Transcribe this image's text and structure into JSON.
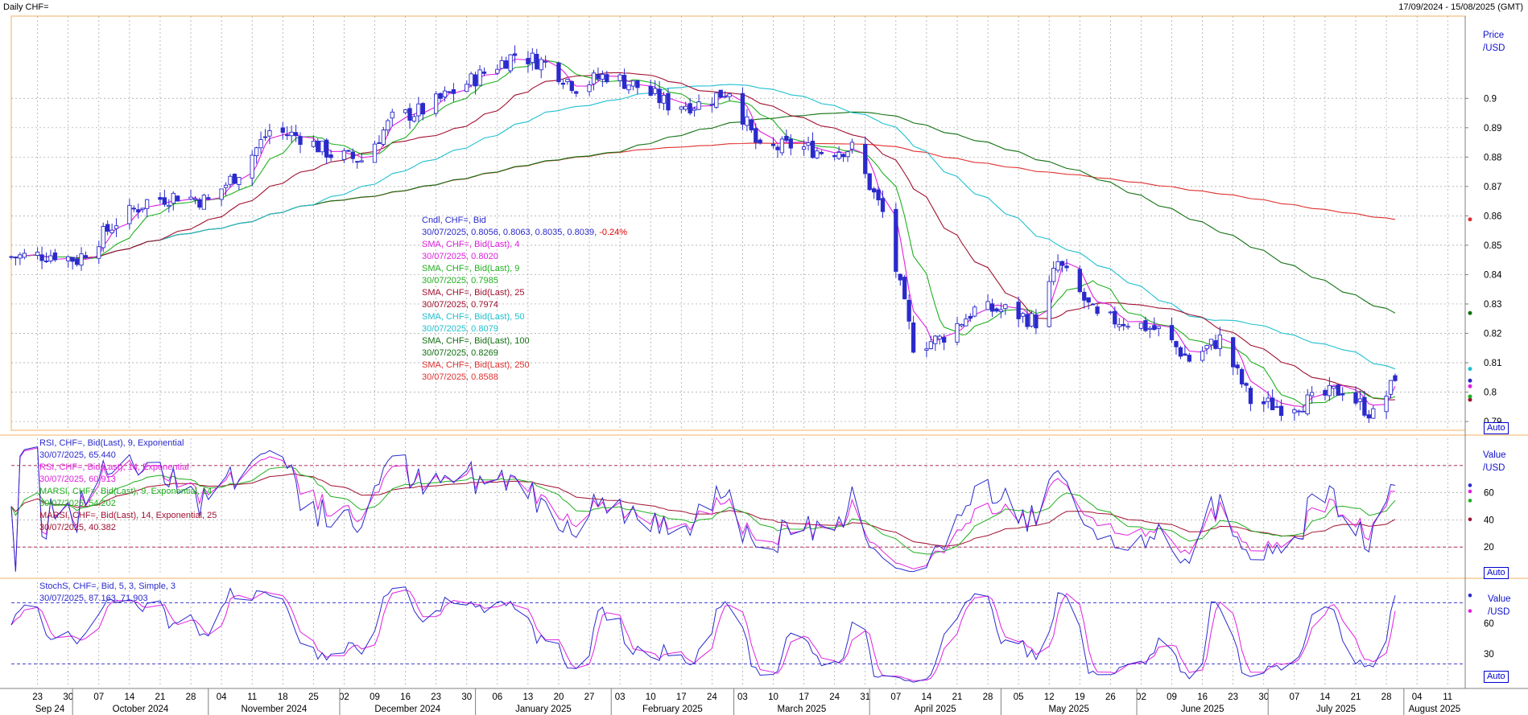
{
  "header": {
    "title": "Daily CHF=",
    "range": "17/09/2024 - 15/08/2025 (GMT)"
  },
  "price_panel": {
    "unit_top": "Price",
    "unit_bottom": "/USD",
    "auto_label": "Auto",
    "legend": [
      {
        "text": "Cndl, CHF=, Bid",
        "color": "#2a2acc"
      },
      {
        "text": "30/07/2025, 0.8056, 0.8063, 0.8035, 0.8039,",
        "color": "#2a2acc",
        "extra": "-0.24%",
        "extra_color": "#e00000"
      },
      {
        "text": "SMA, CHF=, Bid(Last),  4",
        "color": "#e020e0"
      },
      {
        "text": "30/07/2025, 0.8020",
        "color": "#e020e0"
      },
      {
        "text": "SMA, CHF=, Bid(Last),  9",
        "color": "#20b020"
      },
      {
        "text": "30/07/2025, 0.7985",
        "color": "#20b020"
      },
      {
        "text": "SMA, CHF=, Bid(Last),  25",
        "color": "#a01030"
      },
      {
        "text": "30/07/2025, 0.7974",
        "color": "#a01030"
      },
      {
        "text": "SMA, CHF=, Bid(Last),  50",
        "color": "#20c0d0"
      },
      {
        "text": "30/07/2025, 0.8079",
        "color": "#20c0d0"
      },
      {
        "text": "SMA, CHF=, Bid(Last),  100",
        "color": "#107010"
      },
      {
        "text": "30/07/2025, 0.8269",
        "color": "#107010"
      },
      {
        "text": "SMA, CHF=, Bid(Last),  250",
        "color": "#e03030"
      },
      {
        "text": "30/07/2025, 0.8588",
        "color": "#e03030"
      }
    ]
  },
  "rsi_panel": {
    "unit_top": "Value",
    "unit_bottom": "/USD",
    "auto_label": "Auto",
    "legend": [
      {
        "text": "RSI, CHF=, Bid(Last),  9, Exponential",
        "color": "#2a2acc"
      },
      {
        "text": "30/07/2025, 65.440",
        "color": "#2a2acc"
      },
      {
        "text": "RSI, CHF=, Bid(Last),  14, Exponential",
        "color": "#e020e0"
      },
      {
        "text": "30/07/2025, 60.913",
        "color": "#e020e0"
      },
      {
        "text": "MARSI, CHF=, Bid(Last),  9, Exponential,  14",
        "color": "#20b020"
      },
      {
        "text": "30/07/2025, 54.202",
        "color": "#20b020"
      },
      {
        "text": "MARSI, CHF=, Bid(Last),  14, Exponential,  25",
        "color": "#a01030"
      },
      {
        "text": "30/07/2025, 40.382",
        "color": "#a01030"
      }
    ]
  },
  "stoch_panel": {
    "unit_top": "Value",
    "unit_bottom": "/USD",
    "auto_label": "Auto",
    "legend": [
      {
        "text": "StochS, CHF=, Bid,  5, 3, Simple,  3",
        "color": "#2a2acc"
      },
      {
        "text": "30/07/2025, 87.163, 71.903",
        "color": "#2a2acc"
      }
    ]
  },
  "chart_data": [
    {
      "type": "candlestick",
      "title": "Daily CHF=",
      "ylim": [
        0.787,
        0.928
      ],
      "y_ticks": [
        "0.79",
        "0.8",
        "0.81",
        "0.82",
        "0.83",
        "0.84",
        "0.85",
        "0.86",
        "0.87",
        "0.88",
        "0.89",
        "0.9"
      ],
      "grid": true,
      "x_day_labels": [
        "23",
        "30",
        "07",
        "14",
        "21",
        "28",
        "04",
        "11",
        "18",
        "25",
        "02",
        "09",
        "16",
        "23",
        "30",
        "06",
        "13",
        "20",
        "27",
        "03",
        "10",
        "17",
        "24",
        "03",
        "10",
        "17",
        "24",
        "31",
        "07",
        "14",
        "21",
        "28",
        "05",
        "12",
        "19",
        "26",
        "02",
        "09",
        "16",
        "23",
        "30",
        "07",
        "14",
        "21",
        "28",
        "04",
        "11"
      ],
      "x_month_labels": [
        "Sep 24",
        "October 2024",
        "November 2024",
        "December 2024",
        "January 2025",
        "February 2025",
        "March 2025",
        "April 2025",
        "May 2025",
        "June 2025",
        "July 2025",
        "August 2025"
      ],
      "candle_anchors": [
        {
          "date": "2024-09-17",
          "close": 0.846
        },
        {
          "date": "2024-09-27",
          "close": 0.847
        },
        {
          "date": "2024-10-02",
          "close": 0.845
        },
        {
          "date": "2024-10-11",
          "close": 0.858
        },
        {
          "date": "2024-10-18",
          "close": 0.865
        },
        {
          "date": "2024-10-25",
          "close": 0.867
        },
        {
          "date": "2024-11-01",
          "close": 0.865
        },
        {
          "date": "2024-11-08",
          "close": 0.875
        },
        {
          "date": "2024-11-15",
          "close": 0.889
        },
        {
          "date": "2024-11-22",
          "close": 0.887
        },
        {
          "date": "2024-11-29",
          "close": 0.881
        },
        {
          "date": "2024-12-06",
          "close": 0.879
        },
        {
          "date": "2024-12-13",
          "close": 0.893
        },
        {
          "date": "2024-12-20",
          "close": 0.896
        },
        {
          "date": "2024-12-31",
          "close": 0.906
        },
        {
          "date": "2025-01-10",
          "close": 0.915
        },
        {
          "date": "2025-01-17",
          "close": 0.912
        },
        {
          "date": "2025-01-24",
          "close": 0.904
        },
        {
          "date": "2025-01-31",
          "close": 0.908
        },
        {
          "date": "2025-02-07",
          "close": 0.904
        },
        {
          "date": "2025-02-14",
          "close": 0.898
        },
        {
          "date": "2025-02-21",
          "close": 0.898
        },
        {
          "date": "2025-02-28",
          "close": 0.903
        },
        {
          "date": "2025-03-07",
          "close": 0.882
        },
        {
          "date": "2025-03-14",
          "close": 0.884
        },
        {
          "date": "2025-03-21",
          "close": 0.882
        },
        {
          "date": "2025-03-28",
          "close": 0.883
        },
        {
          "date": "2025-04-04",
          "close": 0.861
        },
        {
          "date": "2025-04-11",
          "close": 0.816
        },
        {
          "date": "2025-04-17",
          "close": 0.818
        },
        {
          "date": "2025-04-25",
          "close": 0.828
        },
        {
          "date": "2025-05-02",
          "close": 0.828
        },
        {
          "date": "2025-05-09",
          "close": 0.824
        },
        {
          "date": "2025-05-14",
          "close": 0.844
        },
        {
          "date": "2025-05-23",
          "close": 0.825
        },
        {
          "date": "2025-05-30",
          "close": 0.824
        },
        {
          "date": "2025-06-06",
          "close": 0.821
        },
        {
          "date": "2025-06-13",
          "close": 0.811
        },
        {
          "date": "2025-06-20",
          "close": 0.818
        },
        {
          "date": "2025-06-27",
          "close": 0.797
        },
        {
          "date": "2025-07-04",
          "close": 0.795
        },
        {
          "date": "2025-07-11",
          "close": 0.797
        },
        {
          "date": "2025-07-18",
          "close": 0.801
        },
        {
          "date": "2025-07-25",
          "close": 0.792
        },
        {
          "date": "2025-07-30",
          "close": 0.8039
        }
      ],
      "last_candle": {
        "date": "2025-07-30",
        "open": 0.8056,
        "high": 0.8063,
        "low": 0.8035,
        "close": 0.8039,
        "change": "-0.24%"
      },
      "sma_values": {
        "4": 0.802,
        "9": 0.7985,
        "25": 0.7974,
        "50": 0.8079,
        "100": 0.8269,
        "250": 0.8588
      },
      "series": [
        {
          "name": "Cndl, CHF=, Bid",
          "color": "#2a2acc"
        },
        {
          "name": "SMA, CHF=, Bid(Last),  4",
          "color": "#e020e0"
        },
        {
          "name": "SMA, CHF=, Bid(Last),  9",
          "color": "#20b020"
        },
        {
          "name": "SMA, CHF=, Bid(Last),  25",
          "color": "#a01030"
        },
        {
          "name": "SMA, CHF=, Bid(Last),  50",
          "color": "#20c0d0"
        },
        {
          "name": "SMA, CHF=, Bid(Last),  100",
          "color": "#107010"
        },
        {
          "name": "SMA, CHF=, Bid(Last),  250",
          "color": "#e03030"
        }
      ]
    },
    {
      "type": "line",
      "panel": "RSI",
      "ylim": [
        0,
        100
      ],
      "y_ticks": [
        "20",
        "40",
        "60"
      ],
      "reference_lines": [
        20,
        80
      ],
      "last_values": {
        "RSI 9": 65.44,
        "RSI 14": 60.913,
        "MARSI 9/14": 54.202,
        "MARSI 14/25": 40.382
      }
    },
    {
      "type": "line",
      "panel": "StochS",
      "ylim": [
        0,
        100
      ],
      "y_ticks": [
        "30",
        "60"
      ],
      "reference_lines": [
        20,
        80
      ],
      "last_values": {
        "%K": 87.163,
        "%D": 71.903
      }
    }
  ],
  "colors": {
    "candle": "#2a2acc",
    "grid": "#a0a0a0",
    "panel_border": "#f0b060",
    "ref_line": "#a0103a",
    "axis_text": "#1010cc"
  }
}
